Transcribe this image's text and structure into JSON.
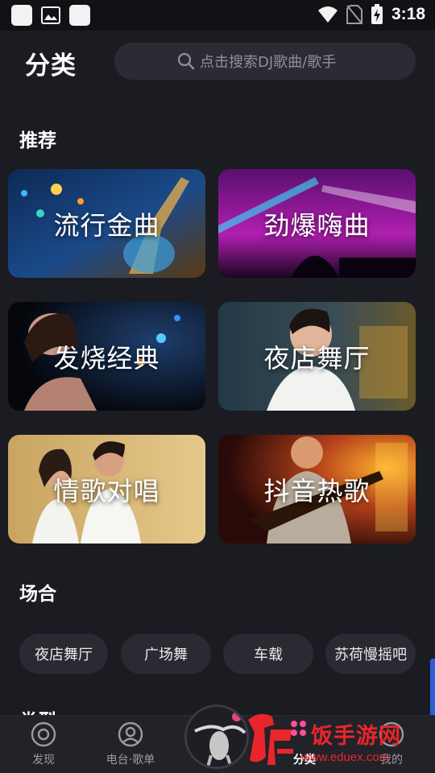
{
  "status_bar": {
    "time": "3:18"
  },
  "header": {
    "title": "分类",
    "search_placeholder": "点击搜索DJ歌曲/歌手"
  },
  "sections": {
    "recommend": "推荐",
    "occasion": "场合",
    "genre": "类型"
  },
  "cards": [
    {
      "label": "流行金曲"
    },
    {
      "label": "劲爆嗨曲"
    },
    {
      "label": "发烧经典"
    },
    {
      "label": "夜店舞厅"
    },
    {
      "label": "情歌对唱"
    },
    {
      "label": "抖音热歌"
    }
  ],
  "chips": [
    "夜店舞厅",
    "广场舞",
    "车载",
    "苏荷慢摇吧"
  ],
  "nav": {
    "discover": "发现",
    "radio": "电台·歌单",
    "category": "分类",
    "mine": "我的"
  },
  "watermark": {
    "text": "饭手游网",
    "url": "www.eduex.com"
  },
  "colors": {
    "background": "#1b1c22",
    "chip": "#2a2b32",
    "accent": "#e8262b"
  }
}
